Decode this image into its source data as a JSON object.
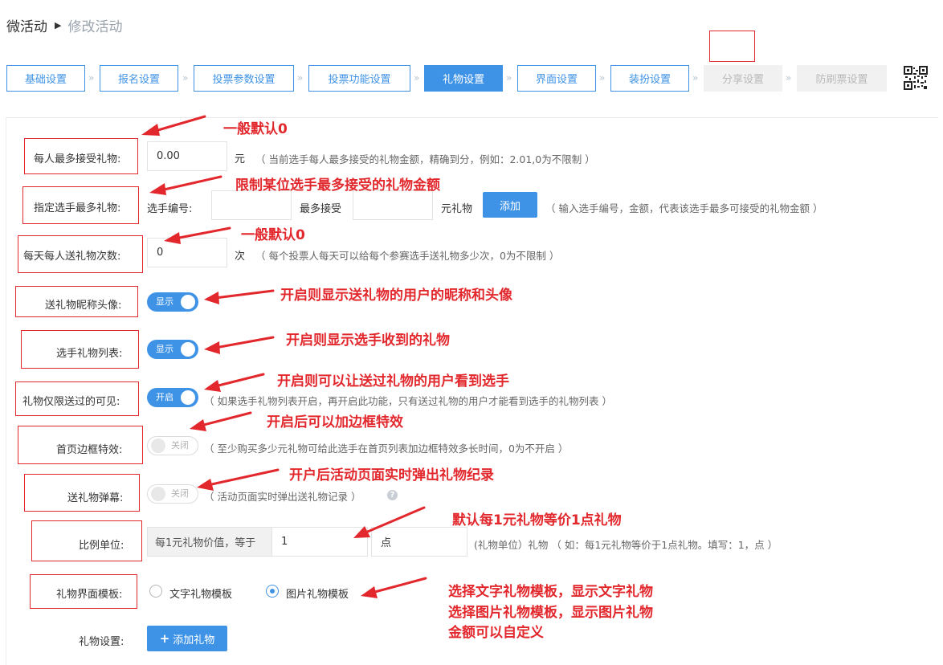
{
  "breadcrumb": {
    "parent": "微活动",
    "current": "修改活动"
  },
  "steps": [
    {
      "label": "基础设置",
      "state": "normal"
    },
    {
      "label": "报名设置",
      "state": "normal"
    },
    {
      "label": "投票参数设置",
      "state": "normal"
    },
    {
      "label": "投票功能设置",
      "state": "normal"
    },
    {
      "label": "礼物设置",
      "state": "active"
    },
    {
      "label": "界面设置",
      "state": "normal"
    },
    {
      "label": "装扮设置",
      "state": "normal"
    },
    {
      "label": "分享设置",
      "state": "disabled"
    },
    {
      "label": "防刷票设置",
      "state": "disabled"
    }
  ],
  "step_separator": "»",
  "qr_icon": "qrcode-icon",
  "form": {
    "max_gift": {
      "label": "每人最多接受礼物:",
      "value": "0.00",
      "unit": "元",
      "hint": "（ 当前选手每人最多接受的礼物金额，精确到分，例如：2.01,0为不限制 ）"
    },
    "player_max_gift": {
      "label": "指定选手最多礼物:",
      "prefix": "选手编号:",
      "mid": "最多接受",
      "unit": "元礼物",
      "add_button": "添加",
      "hint": "（ 输入选手编号，金额，代表该选手最多可接受的礼物金额 ）"
    },
    "daily_times": {
      "label": "每天每人送礼物次数:",
      "value": "0",
      "unit": "次",
      "hint": "（ 每个投票人每天可以给每个参赛选手送礼物多少次，0为不限制 ）"
    },
    "show_avatar": {
      "label": "送礼物昵称头像:",
      "toggle": "显示",
      "on": true
    },
    "gift_list": {
      "label": "选手礼物列表:",
      "toggle": "显示",
      "on": true
    },
    "gift_visible": {
      "label": "礼物仅限送过的可见:",
      "toggle": "开启",
      "on": true,
      "hint": "（ 如果选手礼物列表开启，再开启此功能，只有送过礼物的用户才能看到选手的礼物列表 ）"
    },
    "border_effect": {
      "label": "首页边框特效:",
      "toggle": "关闭",
      "on": false,
      "hint": "（ 至少购买多少元礼物可给此选手在首页列表加边框特效多长时间，0为不开启 ）"
    },
    "barrage": {
      "label": "送礼物弹幕:",
      "toggle": "关闭",
      "on": false,
      "hint": "（ 活动页面实时弹出送礼物记录 ）",
      "help_icon": "question-circle-icon"
    },
    "ratio": {
      "label": "比例单位:",
      "prefix": "每1元礼物价值，等于",
      "value": "1",
      "unit_value": "点",
      "hint": "(礼物单位）礼物  （ 如：每1元礼物等价于1点礼物。填写：1，点 ）"
    },
    "template": {
      "label": "礼物界面模板:",
      "options": [
        "文字礼物模板",
        "图片礼物模板"
      ],
      "selected": 1
    },
    "gift_settings": {
      "label": "礼物设置:",
      "add_button": "添加礼物",
      "add_icon": "plus-icon"
    }
  },
  "annotations": [
    "一般默认0",
    "限制某位选手最多接受的礼物金额",
    "一般默认0",
    "开启则显示送礼物的用户的昵称和头像",
    "开启则显示选手收到的礼物",
    "开启则可以让送过礼物的用户看到选手",
    "开启后可以加边框特效",
    "开户后活动页面实时弹出礼物纪录",
    "默认每1元礼物等价1点礼物",
    "选择文字礼物模板，显示文字礼物",
    "选择图片礼物模板，显示图片礼物",
    "金额可以自定义"
  ],
  "colors": {
    "primary": "#3f93e6",
    "annotation": "#e2282d",
    "disabled": "#f1f1f1"
  }
}
